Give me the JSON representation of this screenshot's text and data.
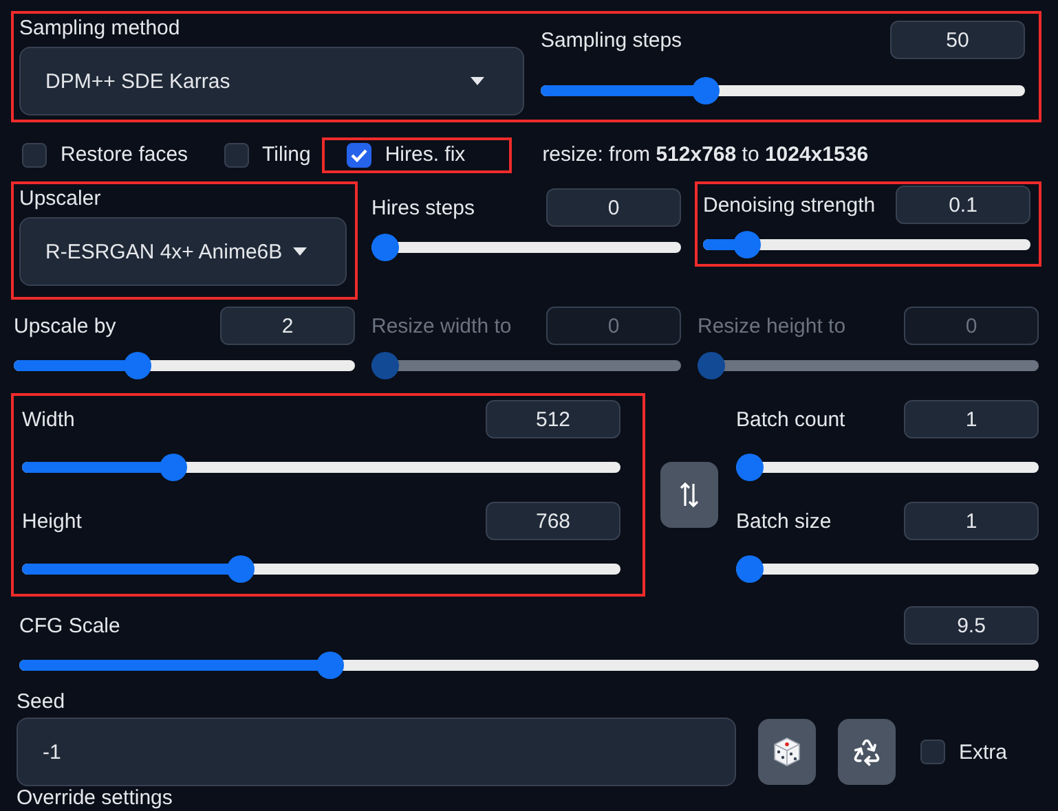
{
  "sampling": {
    "highlighted": true,
    "method": {
      "label": "Sampling method",
      "value": "DPM++ SDE Karras"
    },
    "steps": {
      "label": "Sampling steps",
      "value": "50",
      "level": 0.33,
      "disabled": false,
      "highlighted": false
    }
  },
  "options": [
    {
      "label": "Restore faces",
      "checked": false,
      "highlighted": false
    },
    {
      "label": "Tiling",
      "checked": false,
      "highlighted": false
    },
    {
      "label": "Hires. fix",
      "checked": true,
      "highlighted": true
    }
  ],
  "resize_note": "resize: from **512x768** to **1024x1536**",
  "hires": {
    "upscaler": {
      "label": "Upscaler",
      "value": "R-ESRGAN 4x+ Anime6B",
      "highlighted": true
    },
    "steps": {
      "label": "Hires steps",
      "value": "0",
      "level": 0,
      "disabled": false,
      "highlighted": false
    },
    "denoising": {
      "label": "Denoising strength",
      "value": "0.1",
      "level": 0.1,
      "disabled": false,
      "highlighted": true
    },
    "upscale_by": {
      "label": "Upscale by",
      "value": "2",
      "level": 0.35,
      "disabled": false,
      "highlighted": false
    },
    "resize_width": {
      "label": "Resize width to",
      "value": "0",
      "level": 0,
      "disabled": true,
      "highlighted": false
    },
    "resize_height": {
      "label": "Resize height to",
      "value": "0",
      "level": 0,
      "disabled": true,
      "highlighted": false
    }
  },
  "dimensions": {
    "highlighted": true,
    "width": {
      "label": "Width",
      "value": "512",
      "level": 0.24,
      "disabled": false,
      "highlighted": false
    },
    "height": {
      "label": "Height",
      "value": "768",
      "level": 0.36,
      "disabled": false,
      "highlighted": false
    }
  },
  "batch": [
    {
      "label": "Batch count",
      "value": "1",
      "level": 0,
      "disabled": false,
      "highlighted": false
    },
    {
      "label": "Batch size",
      "value": "1",
      "level": 0,
      "disabled": false,
      "highlighted": false
    }
  ],
  "cfg_scale": {
    "label": "CFG Scale",
    "value": "9.5",
    "level": 0.3,
    "disabled": false,
    "highlighted": false
  },
  "seed": {
    "label": "Seed",
    "value": "-1"
  },
  "extra": {
    "label": "Extra",
    "checked": false
  },
  "override_settings": "Override settings"
}
